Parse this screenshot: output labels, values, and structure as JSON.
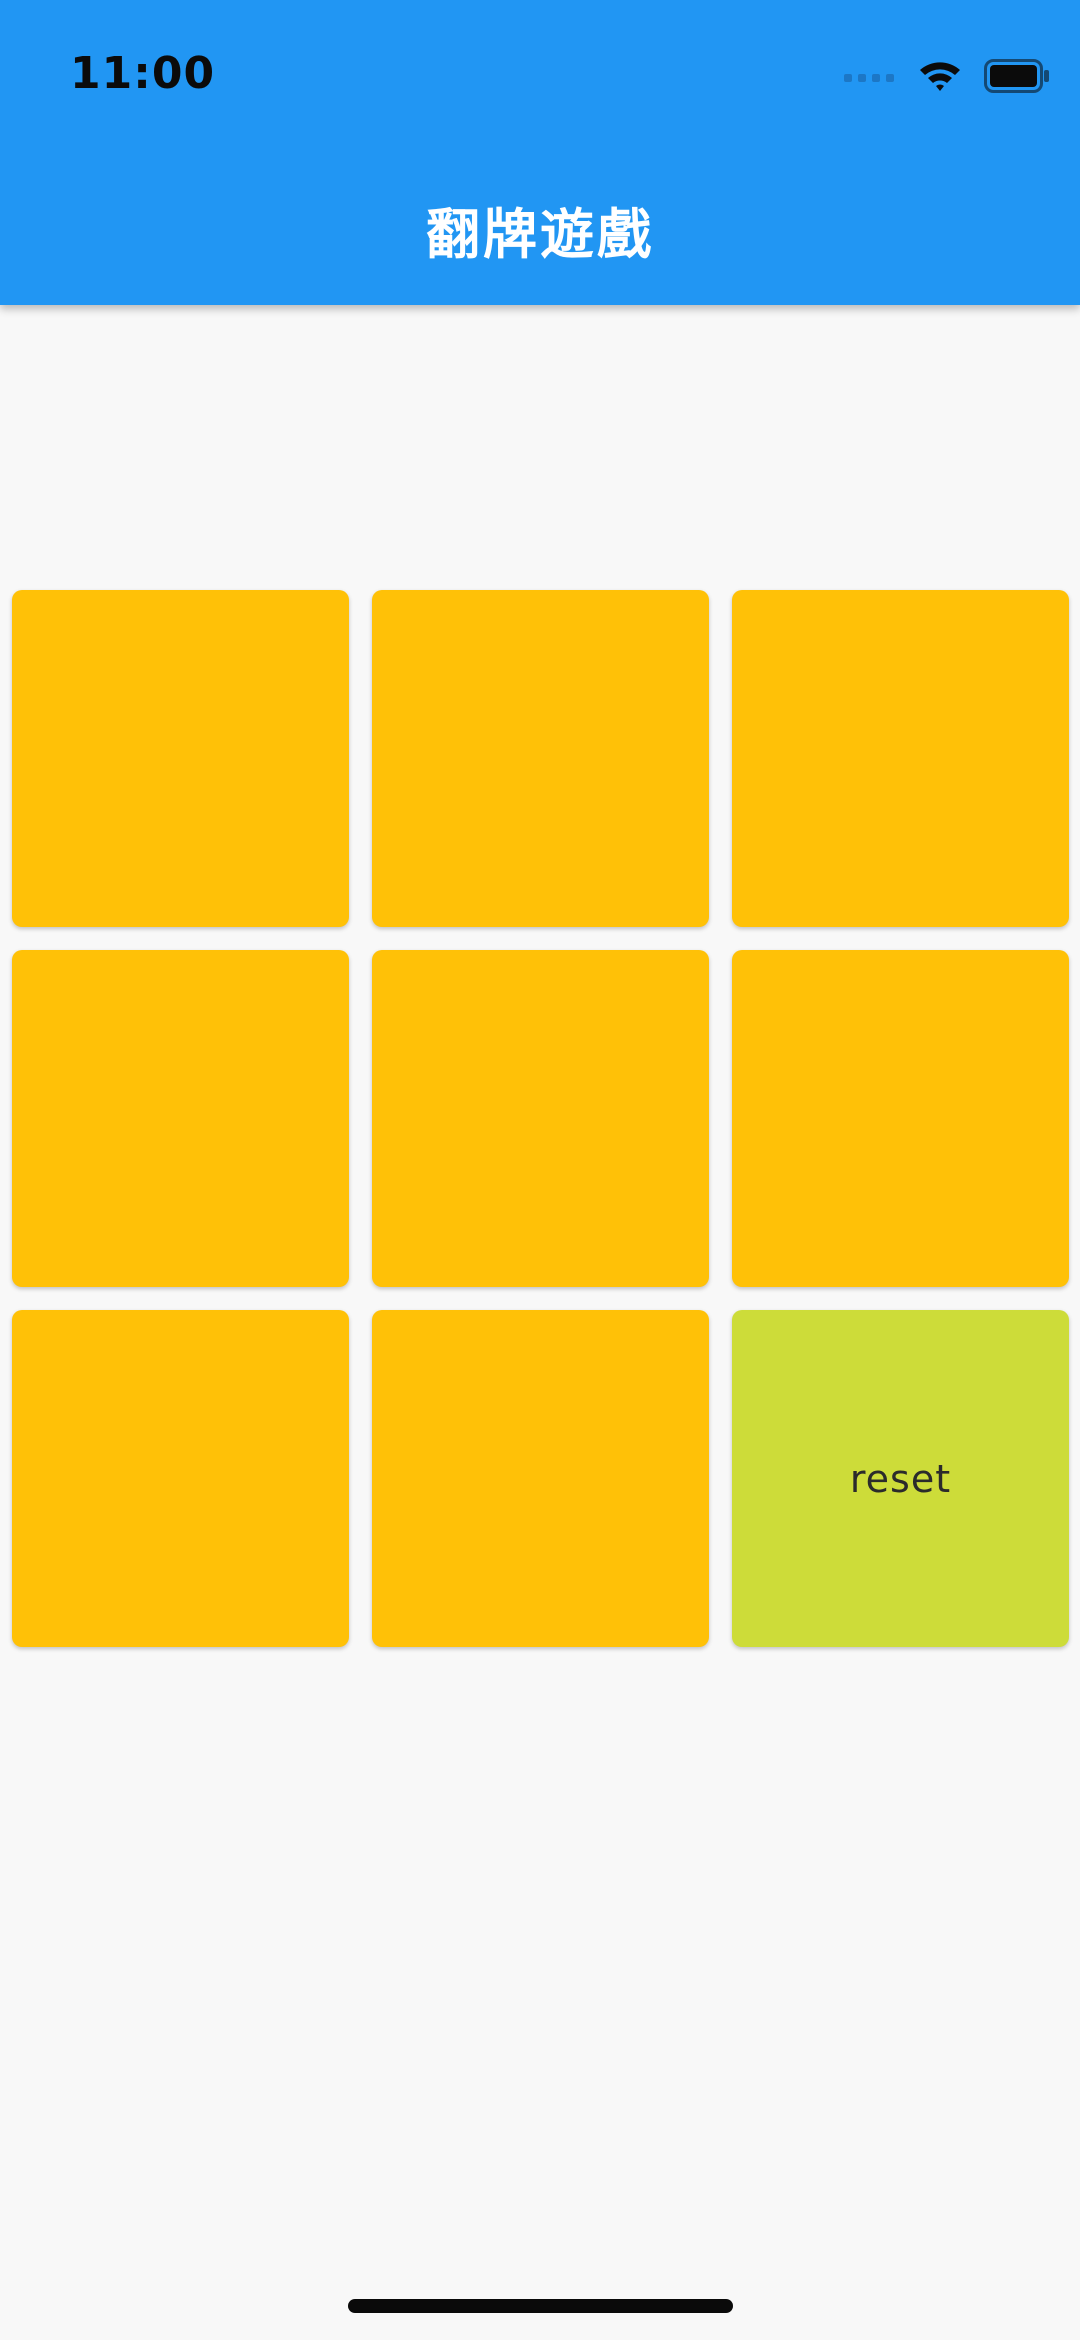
{
  "status_bar": {
    "time": "11:00",
    "icons": [
      "cellular-signal-icon",
      "wifi-icon",
      "battery-icon"
    ]
  },
  "app_bar": {
    "title": "翻牌遊戲"
  },
  "grid": {
    "cards": [
      {
        "label": "",
        "color": "#FFC107"
      },
      {
        "label": "",
        "color": "#FFC107"
      },
      {
        "label": "",
        "color": "#FFC107"
      },
      {
        "label": "",
        "color": "#FFC107"
      },
      {
        "label": "",
        "color": "#FFC107"
      },
      {
        "label": "",
        "color": "#FFC107"
      },
      {
        "label": "",
        "color": "#FFC107"
      },
      {
        "label": "",
        "color": "#FFC107"
      },
      {
        "label": "reset",
        "color": "#CDDC39"
      }
    ]
  },
  "colors": {
    "app_bar": "#2196F3",
    "background": "#F8F8F8",
    "card_back": "#FFC107",
    "reset_card": "#CDDC39"
  }
}
